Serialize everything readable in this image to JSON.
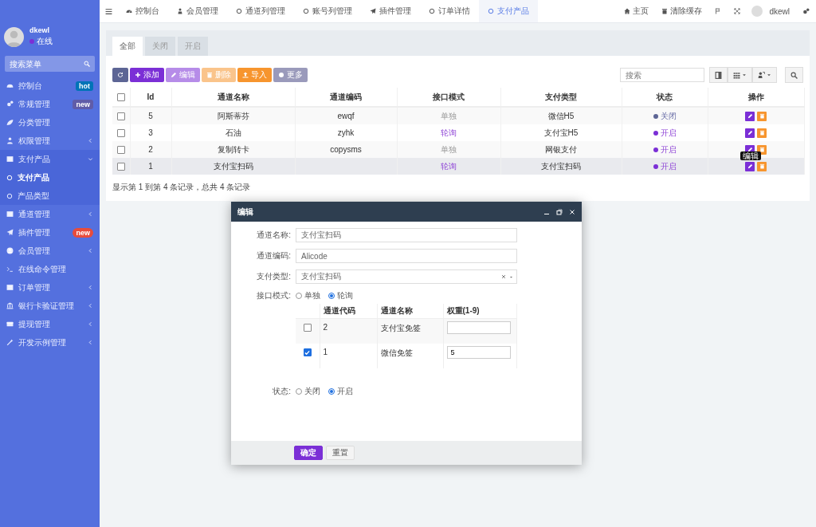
{
  "sidebar": {
    "user": {
      "name": "dkewl",
      "status": "在线"
    },
    "search": {
      "placeholder": "搜索菜单"
    },
    "items": [
      {
        "label": "控制台",
        "selected": false,
        "badge": {
          "text": "hot",
          "color": "#0073b7"
        }
      },
      {
        "label": "常规管理",
        "selected": false,
        "badge": {
          "text": "new",
          "color": "#605ca8"
        }
      },
      {
        "label": "分类管理",
        "selected": false
      },
      {
        "label": "权限管理",
        "selected": false,
        "expanded": false
      },
      {
        "label": "支付产品",
        "selected": false,
        "expanded": true,
        "children": [
          {
            "label": "支付产品",
            "selected": true
          },
          {
            "label": "产品类型",
            "selected": false
          }
        ]
      },
      {
        "label": "通道管理",
        "selected": false,
        "expanded": false
      },
      {
        "label": "插件管理",
        "selected": false,
        "badge": {
          "text": "new",
          "color": "#e74c3c"
        }
      },
      {
        "label": "会员管理",
        "selected": false,
        "expanded": false
      },
      {
        "label": "在线命令管理",
        "selected": false
      },
      {
        "label": "订单管理",
        "selected": false,
        "expanded": false
      },
      {
        "label": "银行卡验证管理",
        "selected": false,
        "expanded": false
      },
      {
        "label": "提现管理",
        "selected": false,
        "expanded": false
      },
      {
        "label": "开发示例管理",
        "selected": false,
        "expanded": false
      }
    ]
  },
  "top_bar": {
    "tabs": [
      {
        "label": "控制台",
        "selected": false
      },
      {
        "label": "会员管理",
        "selected": false
      },
      {
        "label": "通道列管理",
        "selected": false
      },
      {
        "label": "账号列管理",
        "selected": false
      },
      {
        "label": "插件管理",
        "selected": false
      },
      {
        "label": "订单详情",
        "selected": false
      },
      {
        "label": "支付产品",
        "selected": true
      }
    ],
    "links": [
      "主页",
      "清除缓存"
    ],
    "user": "dkewl"
  },
  "panel": {
    "tabs": [
      {
        "label": "全部",
        "selected": true
      },
      {
        "label": "关闭",
        "selected": false
      },
      {
        "label": "开启",
        "selected": false
      }
    ],
    "toolbar": [
      {
        "kind": "refresh",
        "disabled": false
      },
      {
        "kind": "add",
        "label": "添加",
        "disabled": false
      },
      {
        "kind": "edit",
        "label": "编辑",
        "disabled": true
      },
      {
        "kind": "delete",
        "label": "删除",
        "disabled": true
      },
      {
        "kind": "import",
        "label": "导入",
        "disabled": false
      },
      {
        "kind": "more",
        "label": "更多",
        "disabled": false
      }
    ],
    "search": {
      "placeholder": "搜索"
    },
    "table": {
      "all_checked": false,
      "columns": [
        "Id",
        "通道名称",
        "通道编码",
        "接口模式",
        "支付类型",
        "状态",
        "操作"
      ],
      "rows": [
        {
          "checked": false,
          "hovered": false,
          "id": "5",
          "name": "阿斯蒂芬",
          "code": "ewqf",
          "mode": {
            "label": "单独",
            "polling": false
          },
          "pay_type": "微信H5",
          "status": {
            "label": "关闭",
            "on": false
          }
        },
        {
          "checked": false,
          "hovered": false,
          "id": "3",
          "name": "石油",
          "code": "zyhk",
          "mode": {
            "label": "轮询",
            "polling": true
          },
          "pay_type": "支付宝H5",
          "status": {
            "label": "开启",
            "on": true
          }
        },
        {
          "checked": false,
          "hovered": false,
          "id": "2",
          "name": "复制转卡",
          "code": "copysms",
          "mode": {
            "label": "单独",
            "polling": false
          },
          "pay_type": "网银支付",
          "status": {
            "label": "开启",
            "on": true
          }
        },
        {
          "checked": false,
          "hovered": true,
          "id": "1",
          "name": "支付宝扫码",
          "code": "",
          "mode": {
            "label": "轮询",
            "polling": true
          },
          "pay_type": "支付宝扫码",
          "status": {
            "label": "开启",
            "on": true
          },
          "edit_tooltip": "编辑"
        }
      ]
    },
    "footer": "显示第 1 到第 4 条记录，总共 4 条记录"
  },
  "dialog": {
    "title": "编辑",
    "fields": [
      {
        "kind": "text",
        "label": "通道名称:",
        "value": "支付宝扫码"
      },
      {
        "kind": "text",
        "label": "通道编码:",
        "value": "Alicode"
      },
      {
        "kind": "select",
        "label": "支付类型:",
        "value": "支付宝扫码"
      }
    ],
    "mode": {
      "label": "接口模式:",
      "options": [
        {
          "label": "单独",
          "selected": false
        },
        {
          "label": "轮询",
          "selected": true
        }
      ]
    },
    "channels": {
      "columns": [
        "通道代码",
        "通道名称",
        "权重(1-9)"
      ],
      "rows": [
        {
          "checked": false,
          "code": "2",
          "name": "支付宝免签"
        },
        {
          "checked": true,
          "code": "1",
          "name": "微信免签",
          "weight": "5"
        }
      ]
    },
    "status": {
      "label": "状态:",
      "options": [
        {
          "label": "关闭",
          "selected": false
        },
        {
          "label": "开启",
          "selected": true
        }
      ]
    },
    "buttons": [
      {
        "kind": "primary",
        "label": "确定"
      },
      {
        "kind": "default",
        "label": "重置"
      }
    ]
  }
}
